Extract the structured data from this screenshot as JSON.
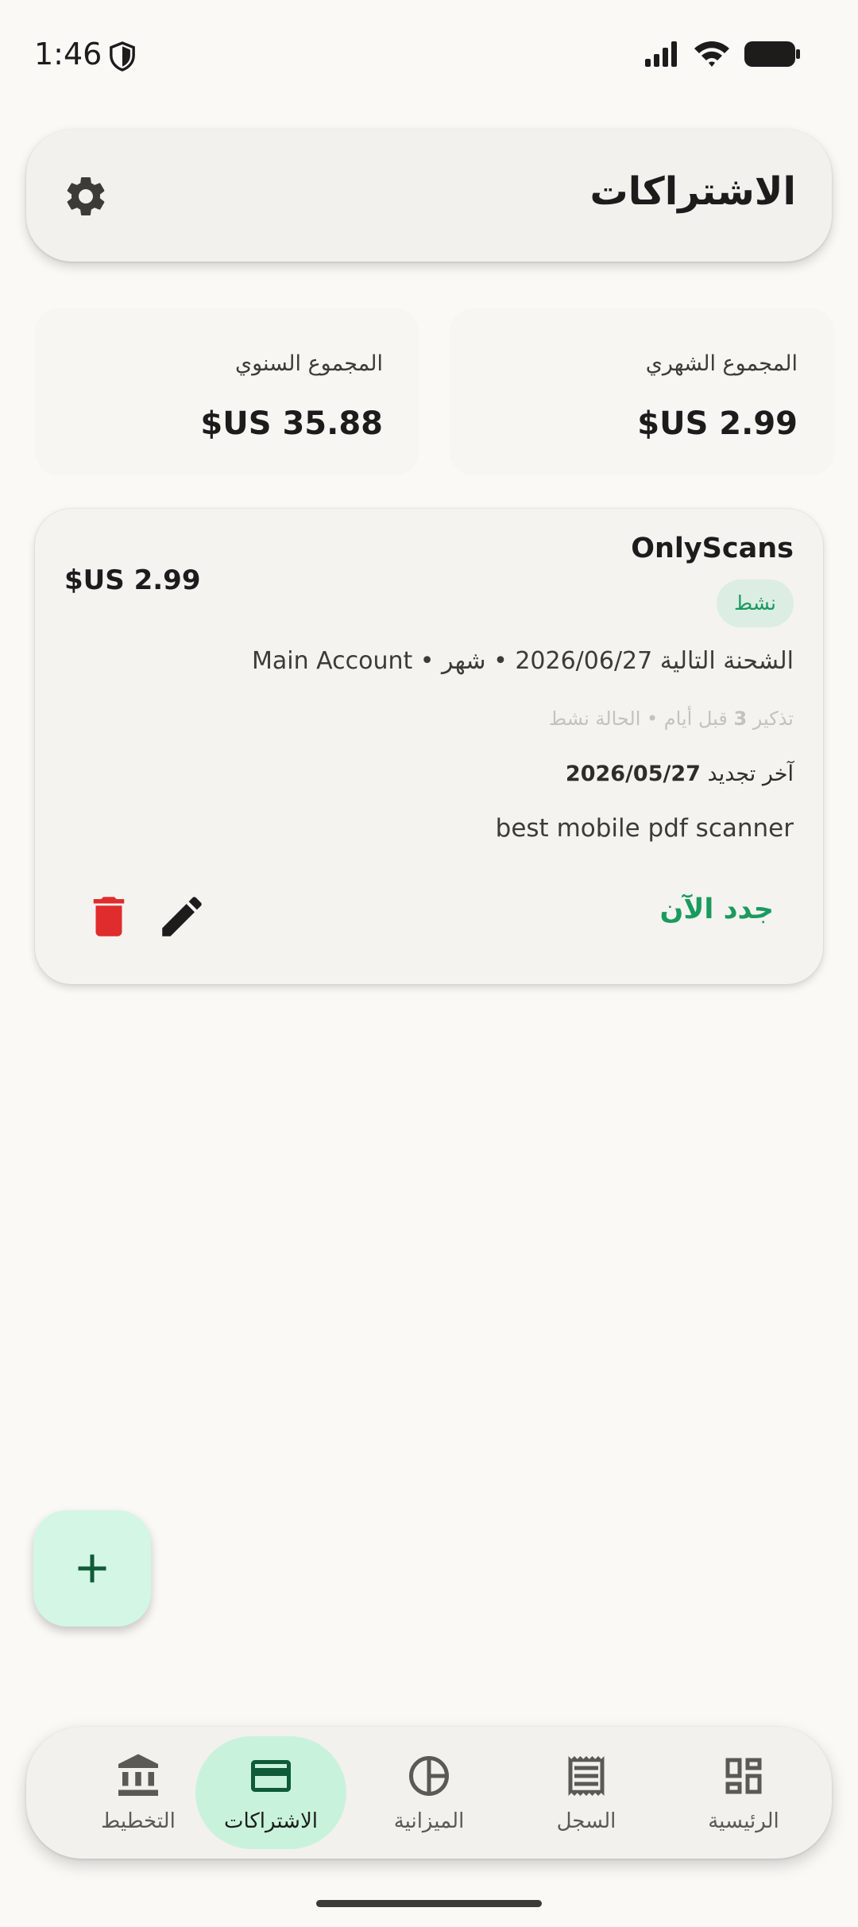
{
  "status_bar": {
    "time": "1:46"
  },
  "header": {
    "title": "الاشتراكات"
  },
  "summary": {
    "monthly": {
      "label": "المجموع الشهري",
      "value": "$US 2.99"
    },
    "yearly": {
      "label": "المجموع السنوي",
      "value": "$US 35.88"
    }
  },
  "subscription": {
    "name": "OnlyScans",
    "price": "$US 2.99",
    "status_badge": "نشط",
    "next_charge": "الشحنة التالية 2026/06/27 • شهر • Main Account",
    "reminder_prefix": "تذكير ",
    "reminder_days": "3",
    "reminder_suffix": " قبل أيام • الحالة نشط",
    "last_renewal_label": "آخر تجديد ",
    "last_renewal_date": "2026/05/27",
    "note": "best mobile pdf scanner",
    "renew_label": "جدد الآن"
  },
  "colors": {
    "accent": "#1a9a5f",
    "delete": "#e02c2c",
    "active_pill": "#c8f2dc",
    "fab": "#d3f6e5"
  },
  "nav": {
    "items": [
      {
        "label": "التخطيط",
        "icon": "bank-icon"
      },
      {
        "label": "الاشتراكات",
        "icon": "card-icon",
        "active": true
      },
      {
        "label": "الميزانية",
        "icon": "pie-chart-icon"
      },
      {
        "label": "السجل",
        "icon": "receipt-icon"
      },
      {
        "label": "الرئيسية",
        "icon": "dashboard-icon"
      }
    ]
  }
}
